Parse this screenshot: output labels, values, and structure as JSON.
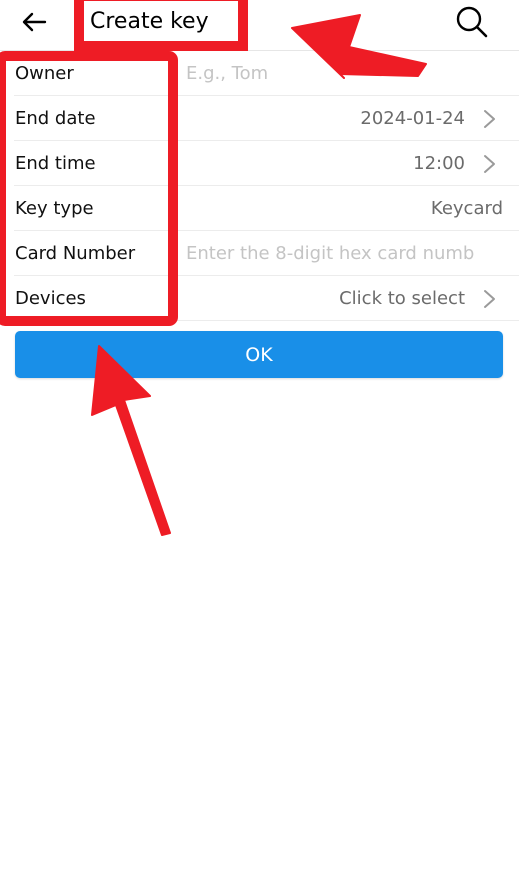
{
  "header": {
    "title": "Create key",
    "back_icon": "arrow-left-icon",
    "search_icon": "search-icon"
  },
  "form": {
    "owner": {
      "label": "Owner",
      "placeholder": "E.g., Tom",
      "value": ""
    },
    "end_date": {
      "label": "End date",
      "value": "2024-01-24"
    },
    "end_time": {
      "label": "End time",
      "value": "12:00"
    },
    "key_type": {
      "label": "Key type",
      "value": "Keycard"
    },
    "card_number": {
      "label": "Card Number",
      "placeholder": "Enter the 8-digit hex card numb",
      "value": ""
    },
    "devices": {
      "label": "Devices",
      "value": "Click to select"
    }
  },
  "actions": {
    "ok_label": "OK"
  },
  "colors": {
    "primary_button": "#198fe8",
    "annotation_red": "#ee1c25",
    "placeholder_text": "#c4c4c4",
    "secondary_text": "#6b6b6b"
  }
}
